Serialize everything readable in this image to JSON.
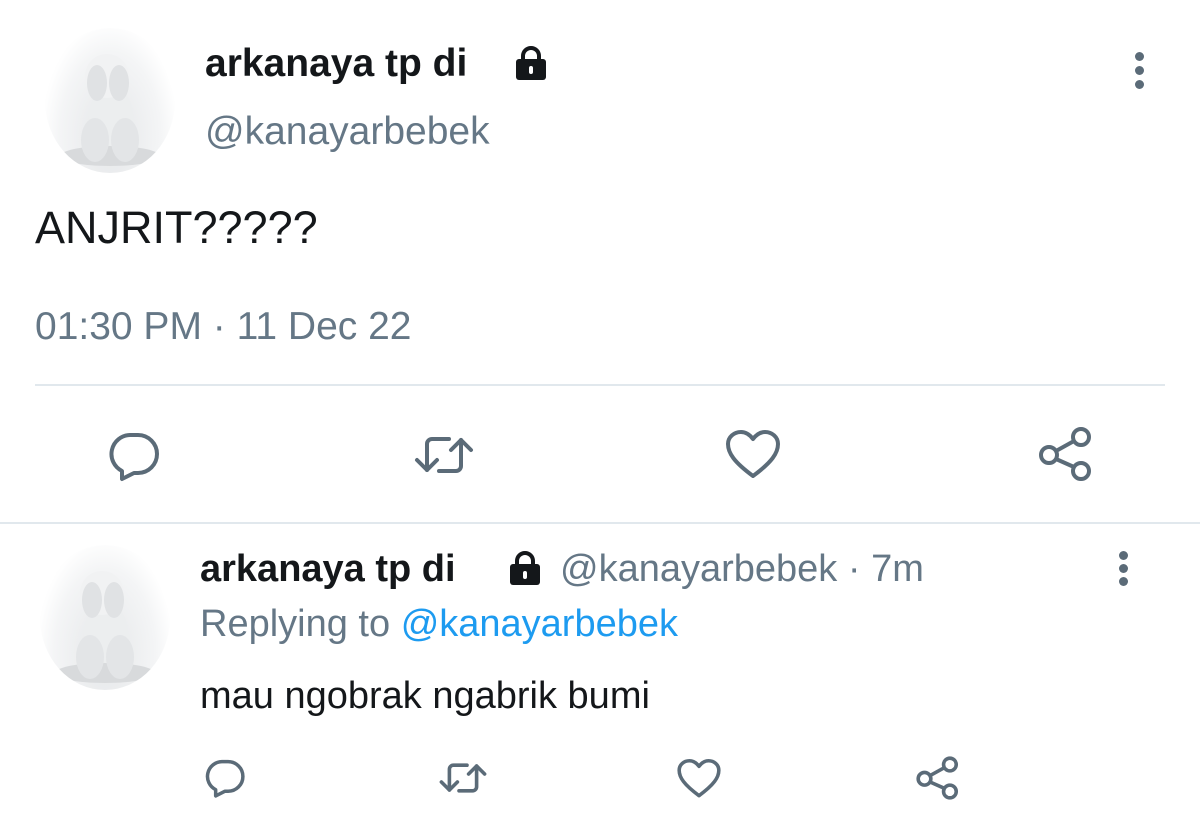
{
  "main_tweet": {
    "author_name": "arkanaya tp di",
    "handle": "@kanayarbebek",
    "text": "ANJRIT?????",
    "timestamp": "01:30 PM · 11 Dec 22",
    "icons": [
      "lock-icon",
      "more-options-icon",
      "reply-icon",
      "retweet-icon",
      "like-icon",
      "share-icon"
    ]
  },
  "reply_tweet": {
    "author_name": "arkanaya tp di",
    "handle_time": "@kanayarbebek · 7m",
    "replying_prefix": "Replying to",
    "replying_to": "@kanayarbebek",
    "text": "mau ngobrak ngabrik bumi",
    "icons": [
      "lock-icon",
      "more-options-icon",
      "reply-icon",
      "retweet-icon",
      "like-icon",
      "share-icon"
    ]
  },
  "colors": {
    "text": "#14171a",
    "muted": "#657786",
    "link": "#1d9bf0",
    "divider": "#e1e8ed"
  }
}
